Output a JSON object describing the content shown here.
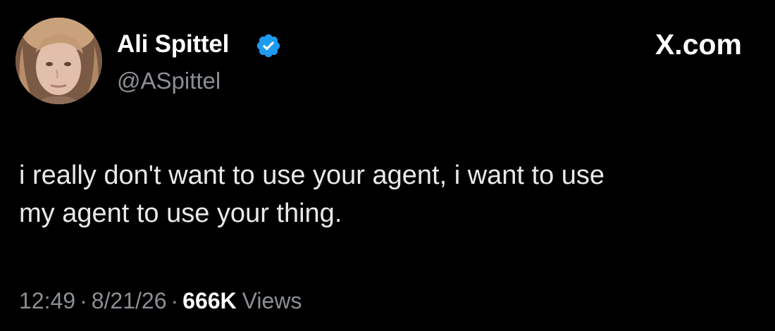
{
  "tweet": {
    "author": {
      "display_name": "Ali Spittel",
      "handle": "@ASpittel",
      "verified": true,
      "avatar_icon": "profile-photo"
    },
    "brand": "X.com",
    "text": "i really don't want to use your agent, i want to use\nmy agent to use your thing.",
    "time": "12:49",
    "date": "8/21/26",
    "separator": "·",
    "views_count": "666K",
    "views_label": "Views"
  },
  "colors": {
    "background": "#000000",
    "primary_text": "#e7e9ea",
    "secondary_text": "#8b8f94",
    "verified_badge": "#1d9bf0"
  }
}
